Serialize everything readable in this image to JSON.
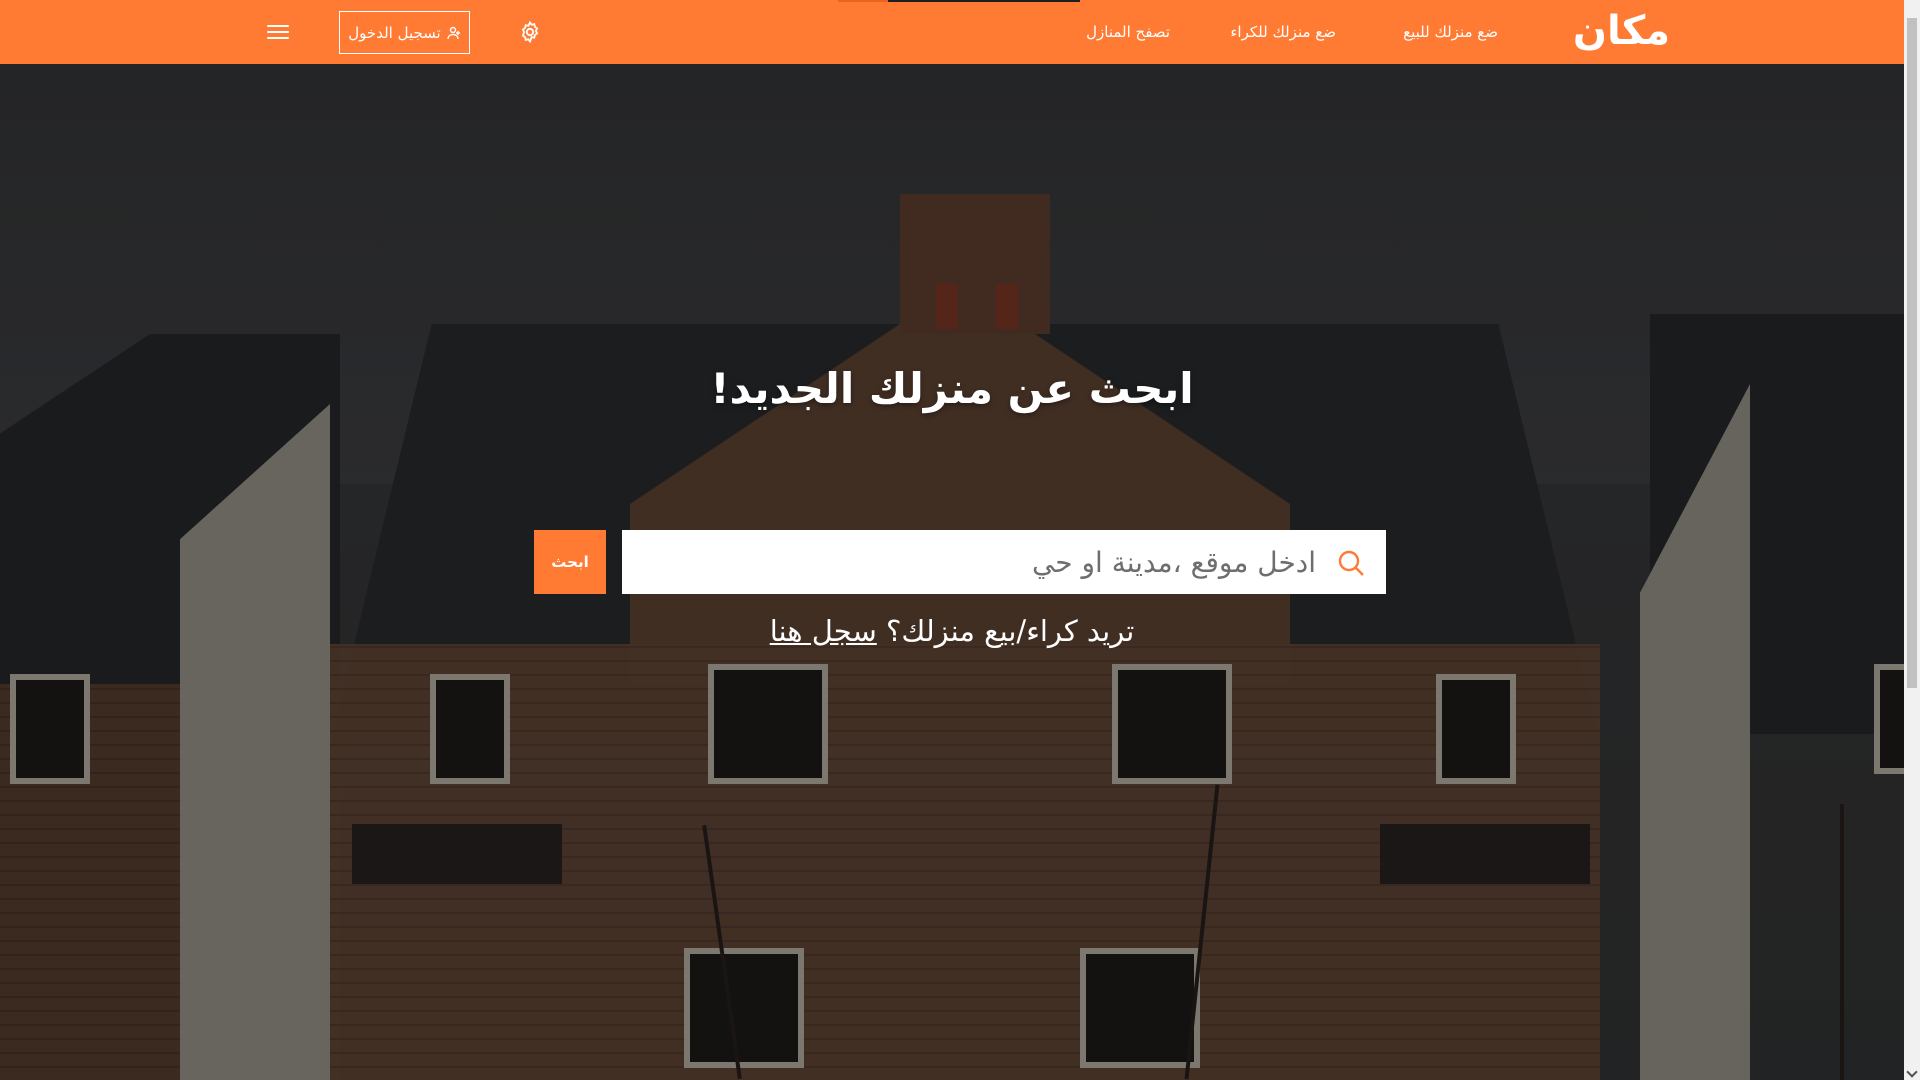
{
  "brand": {
    "logo_text": "مكان",
    "accent_color": "#ff7a33"
  },
  "nav": {
    "links": [
      {
        "label": "ضع منزلك للبيع"
      },
      {
        "label": "ضع منزلك للكراء"
      },
      {
        "label": "تصفح المنازل"
      }
    ],
    "settings_icon": "gear-icon",
    "login_label": "تسجيل الدخول",
    "login_icon": "user-icon",
    "menu_icon": "hamburger-menu-icon"
  },
  "hero": {
    "title": "ابحث عن منزلك الجديد!",
    "search": {
      "placeholder": "ادخل موقع ،مدينة او حي",
      "value": "",
      "icon": "search-icon",
      "button_label": "ابحث"
    },
    "register_prompt": "تريد كراء/بيع منزلك؟",
    "register_link": "سجل هنا"
  }
}
